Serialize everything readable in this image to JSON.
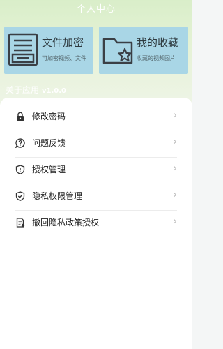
{
  "header": {
    "title": "个人中心"
  },
  "cards": [
    {
      "title": "文件加密",
      "subtitle": "可加密视频、文件",
      "icon": "folder-list-icon"
    },
    {
      "title": "我的收藏",
      "subtitle": "收藏的视频图片",
      "icon": "folder-star-icon"
    }
  ],
  "about": {
    "label": "关于应用",
    "version": "v1.0.0"
  },
  "menu": [
    {
      "label": "修改密码",
      "icon": "lock-icon"
    },
    {
      "label": "问题反馈",
      "icon": "question-icon"
    },
    {
      "label": "授权管理",
      "icon": "shield-alert-icon"
    },
    {
      "label": "隐私权限管理",
      "icon": "shield-check-icon"
    },
    {
      "label": "撤回隐私政策授权",
      "icon": "document-icon"
    }
  ],
  "chevron": "›",
  "colors": {
    "card_bg": "#a9d6e6",
    "hero_bg": "#dff0cf",
    "icon_dark": "#3a3f45",
    "divider": "#ececec"
  }
}
